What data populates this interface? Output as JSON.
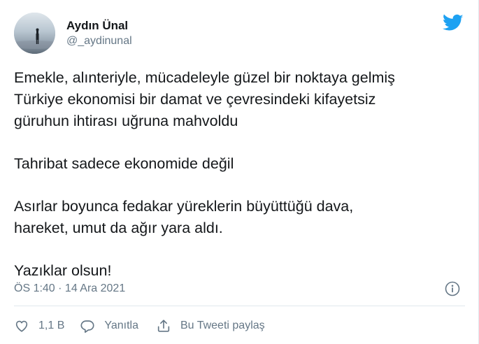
{
  "author": {
    "name": "Aydın Ünal",
    "handle": "@_aydinunal"
  },
  "tweet": {
    "paragraphs": [
      [
        "Emekle, alınteriyle, mücadeleyle güzel bir noktaya gelmiş",
        "Türkiye ekonomisi bir damat ve çevresindeki kifayetsiz",
        "güruhun ihtirası uğruna mahvoldu"
      ],
      [
        "Tahribat sadece ekonomide değil"
      ],
      [
        "Asırlar boyunca fedakar yüreklerin büyüttüğü dava,",
        "hareket, umut da ağır yara aldı."
      ],
      [
        "Yazıklar olsun!"
      ]
    ],
    "timestamp": "ÖS 1:40 · 14 Ara 2021"
  },
  "actions": {
    "like_count": "1,1 B",
    "reply_label": "Yanıtla",
    "share_label": "Bu Tweeti paylaş"
  },
  "icons": {
    "logo": "twitter-bird-icon",
    "info": "info-icon",
    "like": "heart-icon",
    "reply": "speech-bubble-icon",
    "share": "share-icon"
  },
  "colors": {
    "brand": "#1da1f2",
    "text": "#14171a",
    "secondary": "#657786",
    "divider": "#e1e8ed"
  }
}
